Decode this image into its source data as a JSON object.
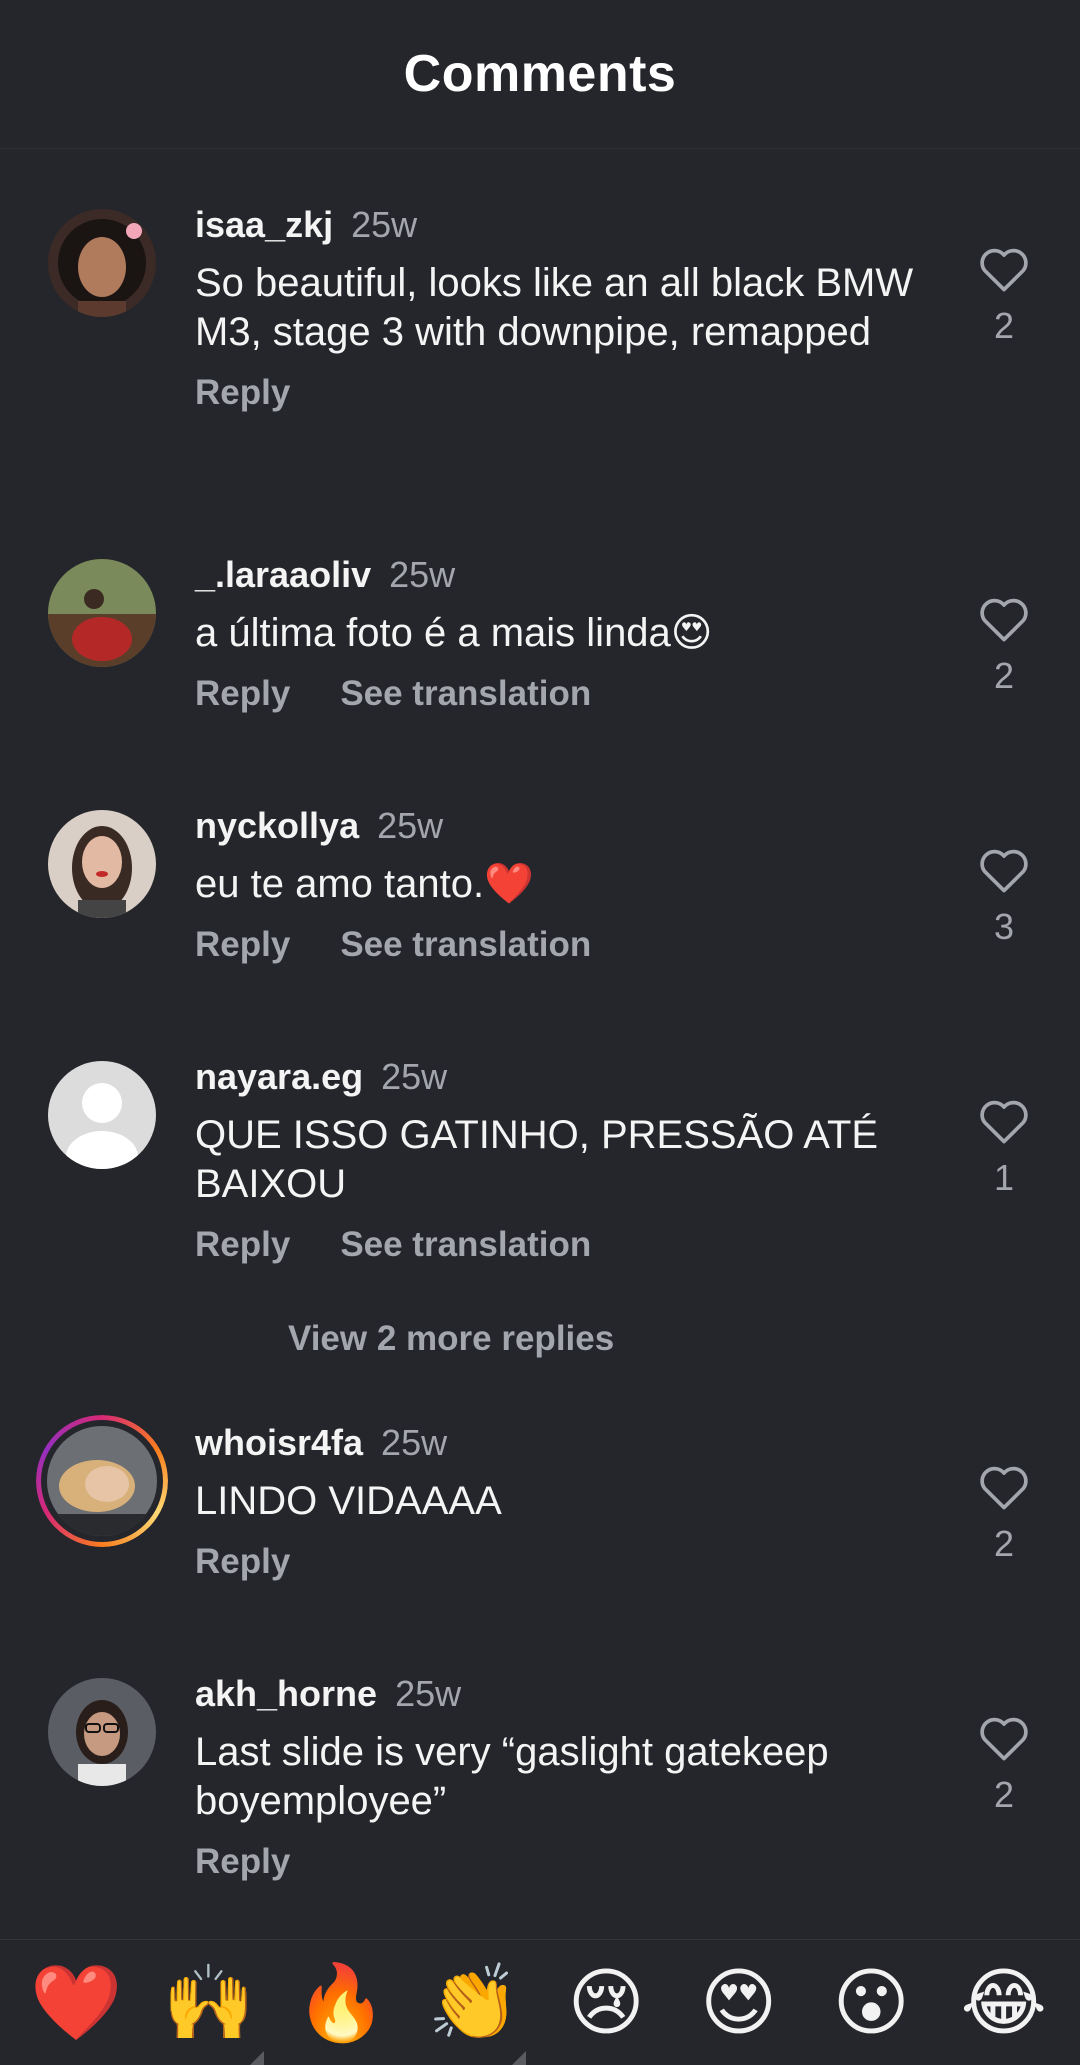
{
  "header": {
    "title": "Comments"
  },
  "comments": [
    {
      "username": "isaa_zkj",
      "time": "25w",
      "text": "So beautiful, looks like an all black BMW M3, stage 3 with downpipe, remapped",
      "reply": "Reply",
      "likes": "2"
    },
    {
      "username": "_.laraaoliv",
      "time": "25w",
      "text": "a última foto é a mais linda😍",
      "reply": "Reply",
      "translate": "See translation",
      "likes": "2"
    },
    {
      "username": "nyckollya",
      "time": "25w",
      "text": "eu te amo tanto.❤️",
      "reply": "Reply",
      "translate": "See translation",
      "likes": "3"
    },
    {
      "username": "nayara.eg",
      "time": "25w",
      "text": "QUE ISSO GATINHO, PRESSÃO ATÉ BAIXOU",
      "reply": "Reply",
      "translate": "See translation",
      "likes": "1",
      "more_replies": "View 2 more replies"
    },
    {
      "username": "whoisr4fa",
      "time": "25w",
      "text": "LINDO VIDAAAA",
      "reply": "Reply",
      "likes": "2"
    },
    {
      "username": "akh_horne",
      "time": "25w",
      "text": "Last slide is very “gaslight gatekeep boyemployee”",
      "reply": "Reply",
      "likes": "2"
    }
  ],
  "emoji_bar": [
    "❤️",
    "🙌",
    "🔥",
    "👏",
    "😢",
    "😍",
    "😮",
    "😂"
  ]
}
